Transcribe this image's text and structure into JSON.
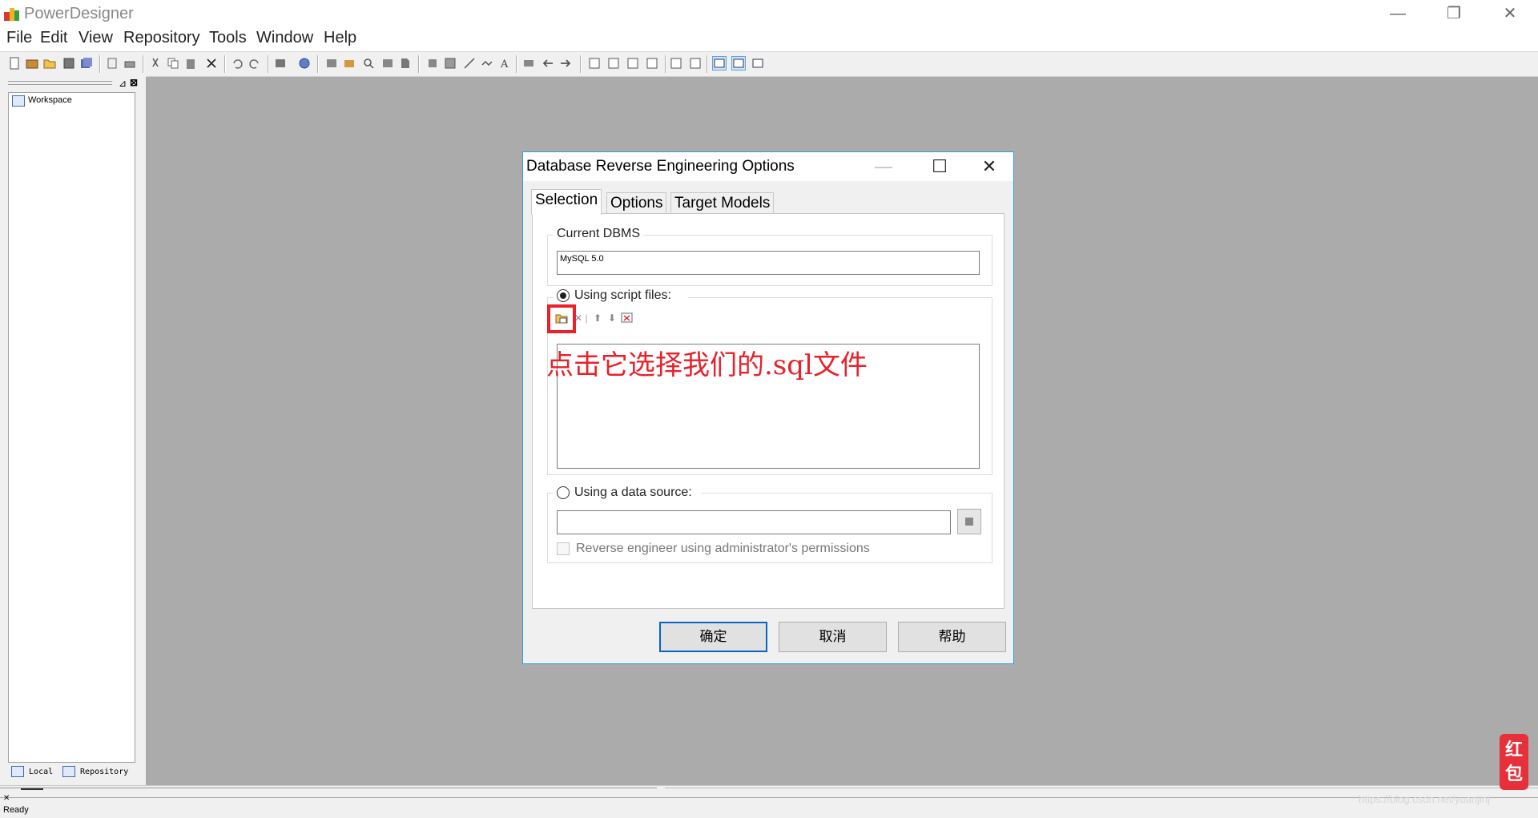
{
  "app": {
    "title": "PowerDesigner"
  },
  "menu": [
    "File",
    "Edit",
    "View",
    "Repository",
    "Tools",
    "Window",
    "Help"
  ],
  "browser": {
    "root_label": "Workspace",
    "tabs": [
      "Local",
      "Repository"
    ]
  },
  "status": {
    "text": "Ready"
  },
  "dialog": {
    "title": "Database Reverse Engineering Options",
    "tabs": [
      "Selection",
      "Options",
      "Target Models"
    ],
    "active_tab": "Selection",
    "current_dbms_label": "Current DBMS",
    "current_dbms_value": "MySQL 5.0",
    "script_files_label": "Using script files:",
    "script_files_selected": true,
    "data_source_label": "Using a data source:",
    "data_source_selected": false,
    "data_source_value": "",
    "admin_permissions_label": "Reverse engineer using administrator's permissions",
    "admin_permissions_checked": false,
    "buttons": {
      "ok": "确定",
      "cancel": "取消",
      "help": "帮助"
    }
  },
  "annotation": {
    "text": "点击它选择我们的.sql文件",
    "color": "#e8212b"
  },
  "overlay": {
    "red_packet": "红包",
    "watermark": "https://blog.csdn.net/yuanjinj"
  }
}
